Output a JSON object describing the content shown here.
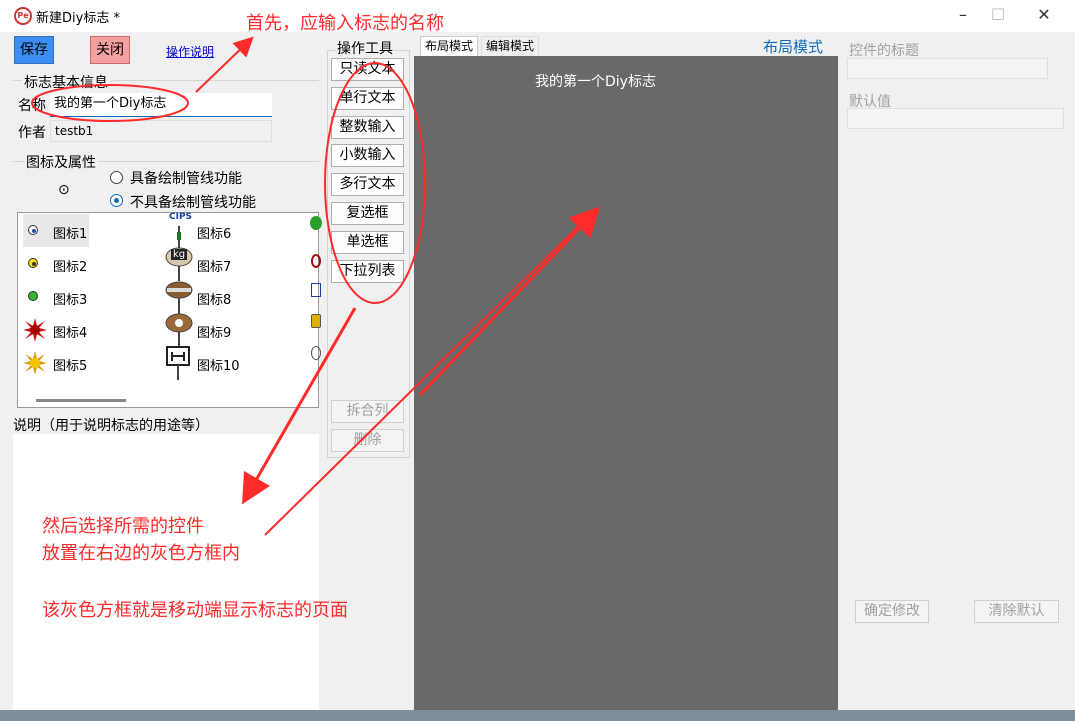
{
  "window": {
    "title": "新建Diy标志 *",
    "minimize": "–",
    "maximize": "☐",
    "close": "✕"
  },
  "toolbar": {
    "save_label": "保存",
    "close_label": "关闭",
    "help_link": "操作说明"
  },
  "basic_info": {
    "group_title": "标志基本信息",
    "name_label": "名称",
    "name_value": "我的第一个Diy标志",
    "author_label": "作者",
    "author_value": "testb1"
  },
  "icon_props": {
    "group_title": "图标及属性",
    "preview_glyph": "⊙",
    "radio_pipeline_on": "具备绘制管线功能",
    "radio_pipeline_off": "不具备绘制管线功能",
    "icons": [
      "图标1",
      "图标2",
      "图标3",
      "图标4",
      "图标5",
      "图标6",
      "图标7",
      "图标8",
      "图标9",
      "图标10"
    ],
    "icon6_caption": "CIPS",
    "icon7_caption": "kg"
  },
  "description": {
    "label": "说明（用于说明标志的用途等）"
  },
  "tools": {
    "title": "操作工具",
    "buttons": [
      "只读文本",
      "单行文本",
      "整数输入",
      "小数输入",
      "多行文本",
      "复选框",
      "单选框",
      "下拉列表"
    ],
    "split_label": "拆合列",
    "delete_label": "删除"
  },
  "tabs": {
    "layout_tab": "布局模式",
    "edit_tab": "编辑模式",
    "mode_title": "布局模式"
  },
  "canvas": {
    "header_text": "我的第一个Diy标志"
  },
  "props": {
    "title_label": "控件的标题",
    "default_label": "默认值",
    "confirm_label": "确定修改",
    "clear_label": "清除默认"
  },
  "annotations": {
    "top_note": "首先，应输入标志的名称",
    "middle_note_line1": "然后选择所需的控件",
    "middle_note_line2": "放置在右边的灰色方框内",
    "bottom_note": "该灰色方框就是移动端显示标志的页面"
  },
  "colors": {
    "accent": "#0f6cbd",
    "annotation": "#ff2a2a",
    "canvas": "#696969",
    "save": "#3c8ef3",
    "close": "#f5a0a0"
  }
}
